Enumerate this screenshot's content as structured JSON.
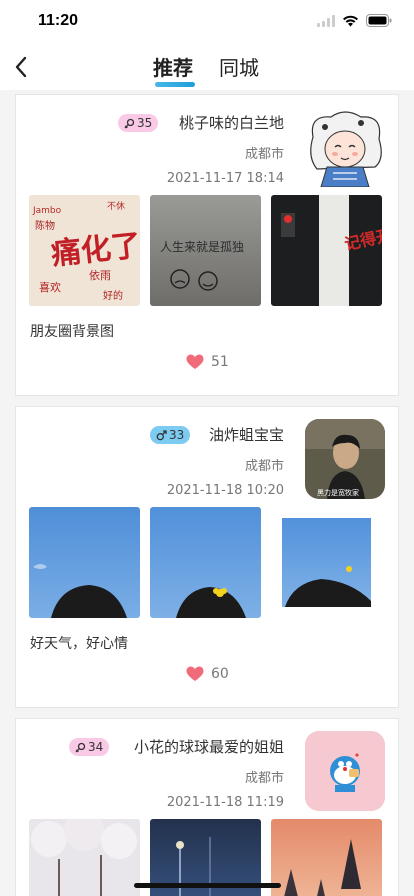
{
  "status": {
    "time": "11:20"
  },
  "nav": {
    "tabs": [
      {
        "label": "推荐"
      },
      {
        "label": "同城"
      }
    ],
    "back_icon": "chevron-left-icon"
  },
  "posts": [
    {
      "gender": "female",
      "age": "35",
      "nickname": "桃子味的白兰地",
      "city": "成都市",
      "time": "2021-11-17 18:14",
      "caption": "朋友圈背景图",
      "likes": "51",
      "avatar": "anime-sheep-avatar"
    },
    {
      "gender": "male",
      "age": "33",
      "nickname": "油炸蛆宝宝",
      "city": "成都市",
      "time": "2021-11-18 10:20",
      "caption": "好天气，好心情",
      "likes": "60",
      "avatar": "man-photo-avatar",
      "avatar_caption": "黑力是宽牧家"
    },
    {
      "gender": "female",
      "age": "34",
      "nickname": "小花的球球最爱的姐姐",
      "city": "成都市",
      "time": "2021-11-18 11:19",
      "avatar": "doraemon-avatar"
    }
  ],
  "photo_text": {
    "wall1_big": "痛化了",
    "wall1_bits": [
      "Jambo",
      "不休",
      "陈物",
      "依雨",
      "喜欢",
      "好的"
    ],
    "wall2": "人生来就是孤独",
    "lamp": "记得开心！"
  },
  "colors": {
    "accent": "#1e9ed9",
    "female_badge": "#f9c9e6",
    "male_badge": "#7ecbf2",
    "heart": "#f06b7a"
  }
}
